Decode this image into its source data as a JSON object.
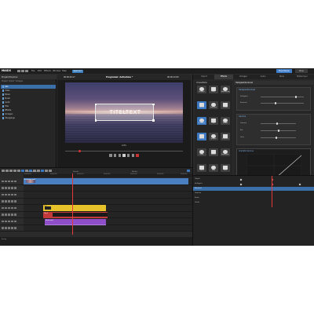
{
  "menubar": {
    "app_name": "MAGIX",
    "menus": [
      "File",
      "Edit",
      "Effects",
      "Window",
      "Help"
    ],
    "badge": "Speichern",
    "export_label": "Exportieren",
    "right_label": "Shop"
  },
  "pool": {
    "title": "Projekt-Explorer",
    "tabs": [
      "Projekt",
      "Import",
      "Vorlagen"
    ],
    "items": [
      "Alle",
      "Video",
      "Bilder",
      "Musik",
      "Audio",
      "Titel",
      "Effekte",
      "Vorlagen",
      "Übergänge"
    ]
  },
  "player": {
    "timecode_left": "00:00:04:17",
    "title": "Programm: Aufnahme *",
    "timecode_right": "00:00:12:00",
    "screen_text": "TITELTEXT",
    "zoom_label": "100%"
  },
  "right_panel": {
    "tabs": [
      "Import",
      "Effekte",
      "Vorlagen",
      "Audio",
      "Store",
      "Mobile Sync"
    ],
    "group_label": "Videoeffekte",
    "icon_labels": [
      [
        "Helligkeit",
        "Farbe",
        "Stabilisierung"
      ],
      [
        "Qualität",
        "Rauschen",
        "Schärfe"
      ],
      [
        "Bewegung",
        "Größe",
        "Position"
      ],
      [
        "Rotation",
        "Spiegeln",
        "Zuschnitt"
      ],
      [
        "Maske",
        "Verlauf",
        "Ausblenden"
      ],
      [
        "Objekt",
        "Form",
        "Mehr"
      ]
    ],
    "props_title": "Helligkeit/Kontrast",
    "section1_title": "Helligkeit/Kontrast",
    "section1_items": [
      "Helligkeit",
      "Kontrast"
    ],
    "section2_title": "Gamma",
    "section2_items": [
      "Gamma",
      "Rot",
      "Grün"
    ],
    "curve_title": "Gradationskurve"
  },
  "keyframes": {
    "rows": [
      "Objekt",
      "Helligkeit",
      "Kontrast",
      "Gamma",
      "Farbe",
      "Größe"
    ]
  },
  "timeline": {
    "toolbar_labels": [
      "Bearbeiten",
      "Schnitt",
      "Effekte"
    ],
    "ruler_ticks": [
      "00:00:00",
      "00:00:05",
      "00:00:10",
      "00:00:15",
      "00:00:20",
      "00:00:25",
      "00:00:30"
    ],
    "clips": [
      {
        "label": "Aufnahme.mp4",
        "color": "#4a7fc2"
      },
      {
        "label": "Titel",
        "color": "#e8c22a"
      },
      {
        "label": "Clip 2",
        "color": "#c23a3a"
      },
      {
        "label": "Musik.mp3",
        "color": "#8e4fc8"
      }
    ]
  },
  "status": {
    "text": "Fertig"
  }
}
